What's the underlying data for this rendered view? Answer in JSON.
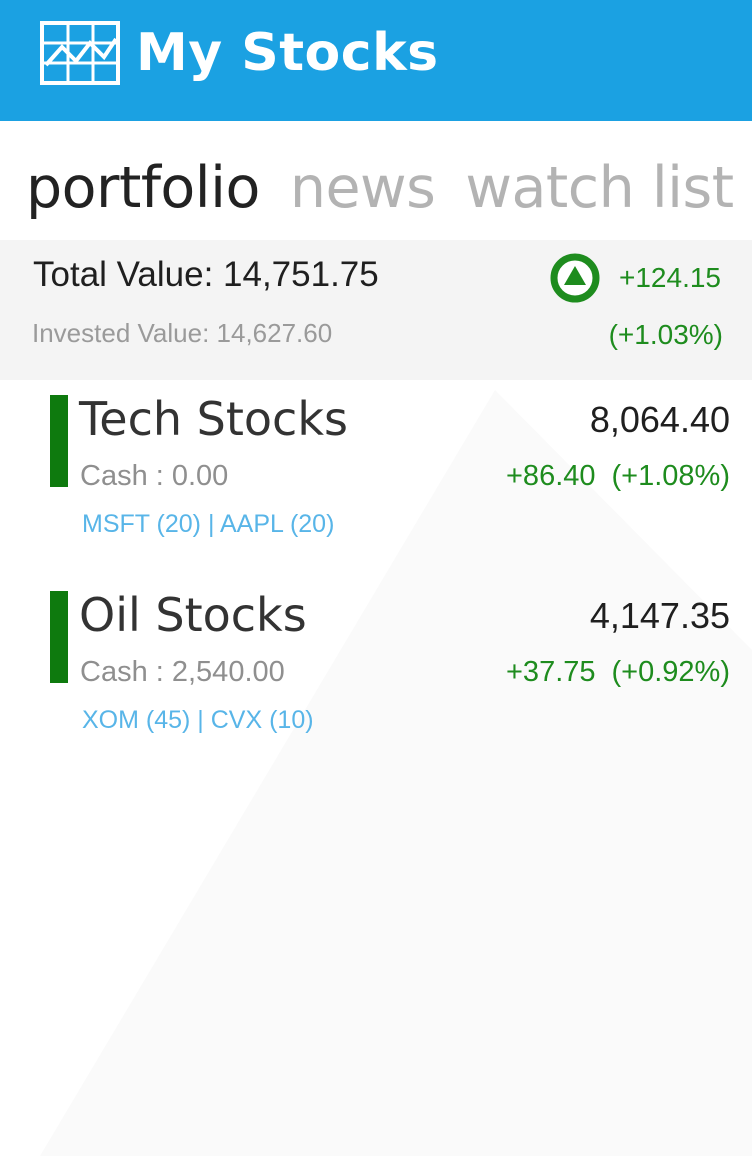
{
  "app": {
    "title": "My Stocks",
    "brand_color": "#1ba1e2",
    "logo_icon": "stock-chart-grid-icon"
  },
  "pivot": {
    "tabs": [
      {
        "label": "portfolio",
        "active": true
      },
      {
        "label": "news",
        "active": false
      },
      {
        "label": "watch list",
        "active": false
      }
    ]
  },
  "summary": {
    "total_value": "Total Value: 14,751.75",
    "invested_value": "Invested Value: 14,627.60",
    "change": "+124.15",
    "change_percent": "(+1.03%)",
    "trend_icon": "up-arrow-circle-icon",
    "positive_color": "#1e8c1e"
  },
  "groups": [
    {
      "name": "Tech Stocks",
      "value": "8,064.40",
      "cash": "Cash : 0.00",
      "change": "+86.40",
      "change_percent": "(+1.08%)",
      "tickers": "MSFT (20) | AAPL (20)"
    },
    {
      "name": "Oil Stocks",
      "value": "4,147.35",
      "cash": "Cash : 2,540.00",
      "change": "+37.75",
      "change_percent": "(+0.92%)",
      "tickers": "XOM (45) | CVX (10)"
    }
  ]
}
